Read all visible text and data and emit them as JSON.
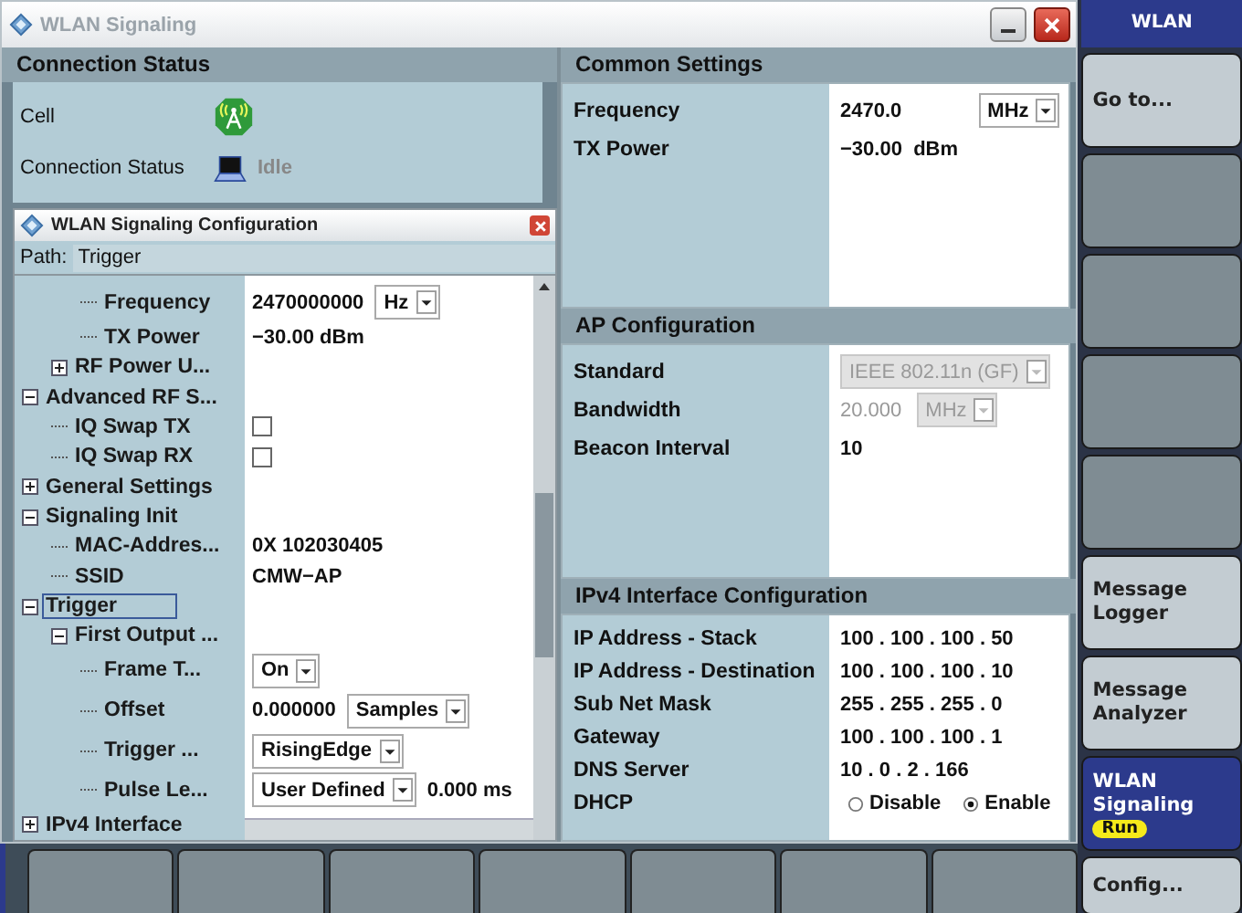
{
  "window": {
    "title": "WLAN Signaling"
  },
  "connection_status": {
    "title": "Connection Status",
    "rows": [
      {
        "kind": "cell",
        "label": "Cell"
      },
      {
        "kind": "status",
        "label": "Connection Status",
        "value": "Idle"
      }
    ]
  },
  "config_dialog": {
    "title": "WLAN Signaling Configuration",
    "path_label": "Path:",
    "path": "Trigger",
    "tree": [
      {
        "children": [
          {
            "children": [
              {
                "label": "Frequency",
                "selected": false,
                "parts": [
                  {
                    "kind": "text",
                    "text": "2470000000",
                    "disabled": false
                  },
                  {
                    "kind": "dropdown",
                    "text": "Hz",
                    "disabled": false
                  }
                ]
              },
              {
                "label": "TX Power",
                "selected": false,
                "parts": [
                  {
                    "kind": "text",
                    "text": "−30.00 dBm",
                    "disabled": false
                  }
                ]
              }
            ]
          },
          {
            "label": "RF Power U...",
            "selected": false,
            "expanded": false
          }
        ]
      },
      {
        "label": "Advanced RF S...",
        "selected": false,
        "expanded": true,
        "children": [
          {
            "label": "IQ Swap TX",
            "selected": false,
            "parts": [
              {
                "kind": "checkbox",
                "checked": false
              }
            ]
          },
          {
            "label": "IQ Swap RX",
            "selected": false,
            "parts": [
              {
                "kind": "checkbox",
                "checked": false
              }
            ]
          }
        ]
      },
      {
        "label": "General Settings",
        "selected": false,
        "expanded": false
      },
      {
        "label": "Signaling Init",
        "selected": false,
        "expanded": true,
        "children": [
          {
            "label": "MAC-Addres...",
            "selected": false,
            "parts": [
              {
                "kind": "text",
                "text": "0X 102030405",
                "disabled": false
              }
            ]
          },
          {
            "label": "SSID",
            "selected": false,
            "parts": [
              {
                "kind": "text",
                "text": "CMW−AP",
                "disabled": false
              }
            ]
          }
        ]
      },
      {
        "label": "Trigger",
        "selected": true,
        "expanded": true,
        "children": [
          {
            "label": "First Output ...",
            "selected": false,
            "expanded": true,
            "children": [
              {
                "label": "Frame T...",
                "selected": false,
                "parts": [
                  {
                    "kind": "dropdown",
                    "text": "On",
                    "disabled": false
                  }
                ]
              },
              {
                "label": "Offset",
                "selected": false,
                "parts": [
                  {
                    "kind": "text",
                    "text": "0.000000",
                    "disabled": false
                  },
                  {
                    "kind": "dropdown",
                    "text": "Samples",
                    "disabled": false
                  }
                ]
              },
              {
                "label": "Trigger ...",
                "selected": false,
                "parts": [
                  {
                    "kind": "dropdown",
                    "text": "RisingEdge",
                    "disabled": false
                  }
                ]
              },
              {
                "label": "Pulse Le...",
                "selected": false,
                "parts": [
                  {
                    "kind": "dropdown",
                    "text": "User Defined",
                    "disabled": false
                  },
                  {
                    "kind": "text",
                    "text": "0.000 ms",
                    "disabled": false
                  }
                ]
              }
            ]
          }
        ]
      },
      {
        "label": "IPv4 Interface",
        "selected": false,
        "expanded": false
      }
    ]
  },
  "sections": [
    {
      "title": "Common Settings",
      "rows": [
        {
          "label": "Frequency",
          "parts": [
            {
              "kind": "text",
              "text": "2470.0",
              "disabled": false
            },
            {
              "kind": "dropdown",
              "text": "MHz",
              "disabled": false
            }
          ]
        },
        {
          "label": "TX Power",
          "parts": [
            {
              "kind": "text",
              "text": "−30.00  dBm",
              "disabled": false
            }
          ]
        }
      ]
    },
    {
      "title": "AP Configuration",
      "rows": [
        {
          "label": "Standard",
          "parts": [
            {
              "kind": "dropdown",
              "text": "IEEE 802.11n (GF)",
              "disabled": true
            }
          ]
        },
        {
          "label": "Bandwidth",
          "parts": [
            {
              "kind": "text",
              "text": "20.000",
              "disabled": true
            },
            {
              "kind": "dropdown",
              "text": "MHz",
              "disabled": true
            }
          ]
        },
        {
          "label": "Beacon Interval",
          "parts": [
            {
              "kind": "text",
              "text": "10",
              "disabled": false
            }
          ]
        }
      ]
    },
    {
      "title": "IPv4 Interface Configuration",
      "rows": [
        {
          "label": "IP Address - Stack",
          "parts": [
            {
              "kind": "text",
              "text": "100 . 100 . 100 . 50",
              "disabled": false
            }
          ]
        },
        {
          "label": "IP Address - Destination",
          "parts": [
            {
              "kind": "text",
              "text": "100 . 100 . 100 . 10",
              "disabled": false
            }
          ]
        },
        {
          "label": "Sub Net Mask",
          "parts": [
            {
              "kind": "text",
              "text": "255 . 255 . 255 . 0",
              "disabled": false
            }
          ]
        },
        {
          "label": "Gateway",
          "parts": [
            {
              "kind": "text",
              "text": "100 . 100 . 100 . 1",
              "disabled": false
            }
          ]
        },
        {
          "label": "DNS Server",
          "parts": [
            {
              "kind": "text",
              "text": "10 . 0 . 2 . 166",
              "disabled": false
            }
          ]
        },
        {
          "label": "DHCP",
          "parts": [
            {
              "kind": "radio",
              "text": "Disable",
              "selected": false
            },
            {
              "kind": "radio",
              "text": "Enable",
              "selected": true
            }
          ]
        }
      ]
    }
  ],
  "softkeys": {
    "title": "WLAN",
    "keys": [
      {
        "label": "Go to...",
        "disabled": false,
        "selected": false
      },
      {
        "disabled": true,
        "selected": false
      },
      {
        "disabled": true,
        "selected": false
      },
      {
        "disabled": true,
        "selected": false
      },
      {
        "disabled": true,
        "selected": false
      },
      {
        "label": "Message Logger",
        "disabled": false,
        "selected": false
      },
      {
        "label": "Message Analyzer",
        "disabled": false,
        "selected": false
      },
      {
        "label": "WLAN Signaling",
        "badge": "Run",
        "disabled": false,
        "selected": true
      },
      {
        "label": "Config...",
        "disabled": false,
        "selected": false
      }
    ]
  },
  "bottom_keys": [
    {
      "disabled": true
    },
    {
      "disabled": true
    },
    {
      "disabled": true
    },
    {
      "disabled": true
    },
    {
      "disabled": true
    },
    {
      "disabled": true
    },
    {
      "disabled": true
    }
  ]
}
